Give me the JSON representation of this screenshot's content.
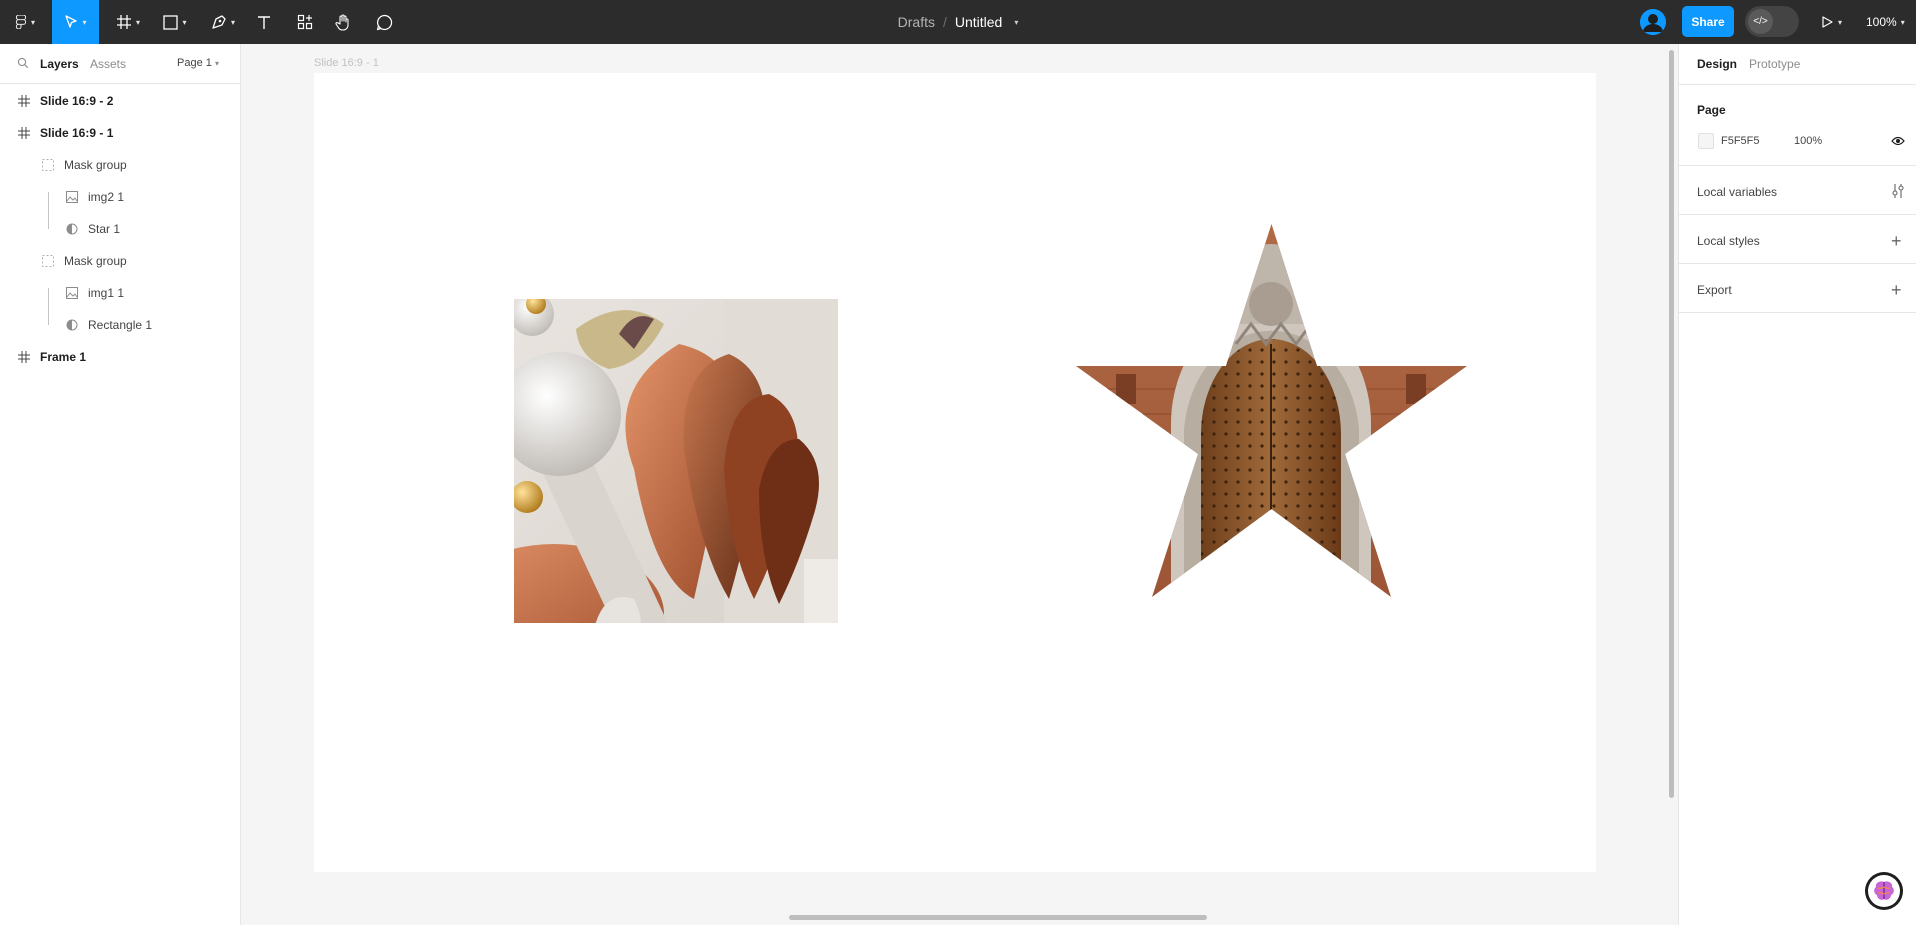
{
  "toolbar": {
    "breadcrumb_parent": "Drafts",
    "breadcrumb_separator": "/",
    "file_name": "Untitled",
    "share_label": "Share",
    "zoom_label": "100%",
    "accent_color": "#0d99ff",
    "icons": [
      "figma-menu-icon",
      "move-tool-icon",
      "frame-tool-icon",
      "shape-tool-icon",
      "pen-tool-icon",
      "text-tool-icon",
      "resources-icon",
      "hand-tool-icon",
      "comment-icon",
      "code-icon",
      "play-icon"
    ]
  },
  "left_panel": {
    "tab_layers": "Layers",
    "tab_assets": "Assets",
    "page_selector": "Page 1",
    "layers": [
      {
        "label": "Slide 16:9 - 2",
        "type": "frame"
      },
      {
        "label": "Slide 16:9 - 1",
        "type": "frame"
      },
      {
        "label": "Mask group",
        "type": "mask"
      },
      {
        "label": "img2 1",
        "type": "image"
      },
      {
        "label": "Star 1",
        "type": "mask-shape"
      },
      {
        "label": "Mask group",
        "type": "mask"
      },
      {
        "label": "img1 1",
        "type": "image"
      },
      {
        "label": "Rectangle 1",
        "type": "mask-shape"
      },
      {
        "label": "Frame 1",
        "type": "frame"
      }
    ]
  },
  "canvas": {
    "frame_label": "Slide 16:9 - 1",
    "background_color": "#F5F5F5",
    "slide_color": "#FFFFFF"
  },
  "right_panel": {
    "tab_design": "Design",
    "tab_prototype": "Prototype",
    "page_section_title": "Page",
    "page_color_hex": "F5F5F5",
    "page_opacity": "100%",
    "local_variables": "Local variables",
    "local_styles": "Local styles",
    "export": "Export"
  }
}
